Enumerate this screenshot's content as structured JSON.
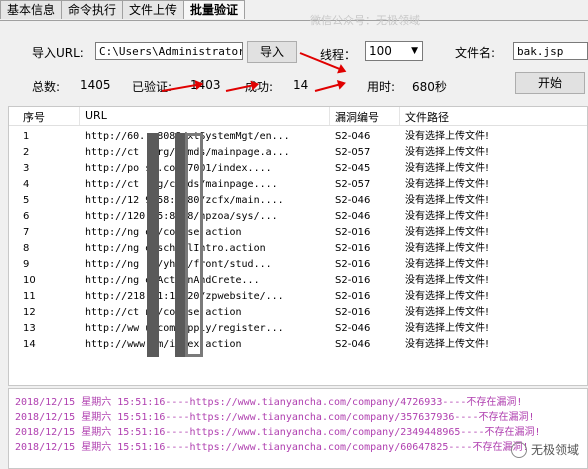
{
  "tabs": [
    {
      "label": "基本信息"
    },
    {
      "label": "命令执行"
    },
    {
      "label": "文件上传"
    },
    {
      "label": "批量验证"
    }
  ],
  "watermark": "微信公众号：无极领域",
  "form": {
    "import_url_label": "导入URL:",
    "import_url_value": "C:\\Users\\Administrator\\D",
    "import_button": "导入",
    "threads_label": "线程：",
    "threads_value": "100",
    "filename_label": "文件名:",
    "filename_value": "bak.jsp",
    "total_label": "总数:",
    "total_value": "1405",
    "verified_label": "已验证:",
    "verified_value": "1403",
    "success_label": "成功:",
    "success_value": "14",
    "time_label": "用时:",
    "time_value": "680秒",
    "start_button": "开始"
  },
  "table": {
    "columns": [
      "序号",
      "URL",
      "漏洞编号",
      "文件路径"
    ],
    "rows": [
      {
        "no": "1",
        "url": "http://60.      :8088/xtSystemMgt/en...",
        "vuln": "S2-046",
        "path": "没有选择上传文件!"
      },
      {
        "no": "2",
        "url": "http://ct      .org/camds/mainpage.a...",
        "vuln": "S2-057",
        "path": "没有选择上传文件!"
      },
      {
        "no": "3",
        "url": "http://po      ss.com:7001/index....",
        "vuln": "S2-045",
        "path": "没有选择上传文件!"
      },
      {
        "no": "4",
        "url": "http://ct      .og/camds/mainpage....",
        "vuln": "S2-057",
        "path": "没有选择上传文件!"
      },
      {
        "no": "5",
        "url": "http://12      9.58:9080/zcfx/main....",
        "vuln": "S2-046",
        "path": "没有选择上传文件!"
      },
      {
        "no": "6",
        "url": "http://120      .5:8088/hpzoa/sys/...",
        "vuln": "S2-046",
        "path": "没有选择上传文件!"
      },
      {
        "no": "7",
        "url": "http://ng      et/course.action",
        "vuln": "S2-016",
        "path": "没有选择上传文件!"
      },
      {
        "no": "8",
        "url": "http://ng      etschoolIntro.action",
        "vuln": "S2-016",
        "path": "没有选择上传文件!"
      },
      {
        "no": "9",
        "url": "http://ng      .m/yhcz/front/stud...",
        "vuln": "S2-016",
        "path": "没有选择上传文件!"
      },
      {
        "no": "10",
        "url": "http://ng      etActionAndCrete...",
        "vuln": "S2-016",
        "path": "没有选择上传文件!"
      },
      {
        "no": "11",
        "url": "http://218      21:10020/zpwebsite/...",
        "vuln": "S2-016",
        "path": "没有选择上传文件!"
      },
      {
        "no": "12",
        "url": "http://ct      ne/course.action",
        "vuln": "S2-016",
        "path": "没有选择上传文件!"
      },
      {
        "no": "13",
        "url": "http://ww      u.com/apply/register...",
        "vuln": "S2-046",
        "path": "没有选择上传文件!"
      },
      {
        "no": "14",
        "url": "http://www      .m/index.action",
        "vuln": "S2-046",
        "path": "没有选择上传文件!"
      }
    ]
  },
  "log": [
    "2018/12/15 星期六 15:51:16----https://www.tianyancha.com/company/4726933----不存在漏洞!",
    "2018/12/15 星期六 15:51:16----https://www.tianyancha.com/company/357637936----不存在漏洞!",
    "2018/12/15 星期六 15:51:16----https://www.tianyancha.com/company/2349448965----不存在漏洞!",
    "2018/12/15 星期六 15:51:16----https://www.tianyancha.com/company/60647825----不存在漏洞!"
  ],
  "brand_watermark": "无极领域",
  "colors": {
    "arrow": "#e00000",
    "log_text": "#b040b0"
  }
}
